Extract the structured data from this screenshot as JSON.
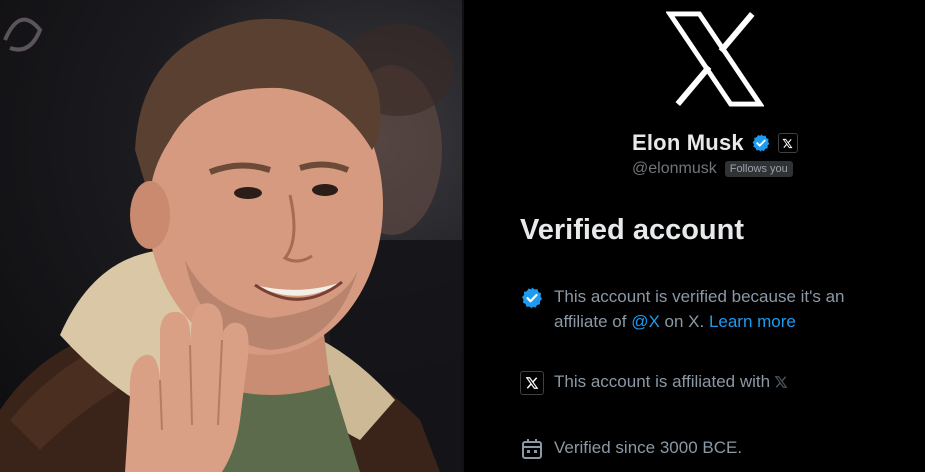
{
  "profile": {
    "display_name": "Elon Musk",
    "handle": "@elonmusk",
    "follows_badge": "Follows you"
  },
  "verification": {
    "heading": "Verified account",
    "reason_text": "This account is verified because it's an affiliate of ",
    "affiliate_link": "@X",
    "reason_suffix": " on X. ",
    "learn_more": "Learn more",
    "affiliated_text": "This account is affiliated with",
    "verified_since": "Verified since 3000 BCE."
  },
  "colors": {
    "background": "#000000",
    "primary_text": "#e7e9ea",
    "secondary_text": "#8b98a5",
    "link": "#1d9bf0",
    "badge_blue": "#1d9bf0"
  },
  "icons": [
    "x-logo-icon",
    "verified-badge-icon",
    "x-affiliate-icon",
    "calendar-icon"
  ]
}
